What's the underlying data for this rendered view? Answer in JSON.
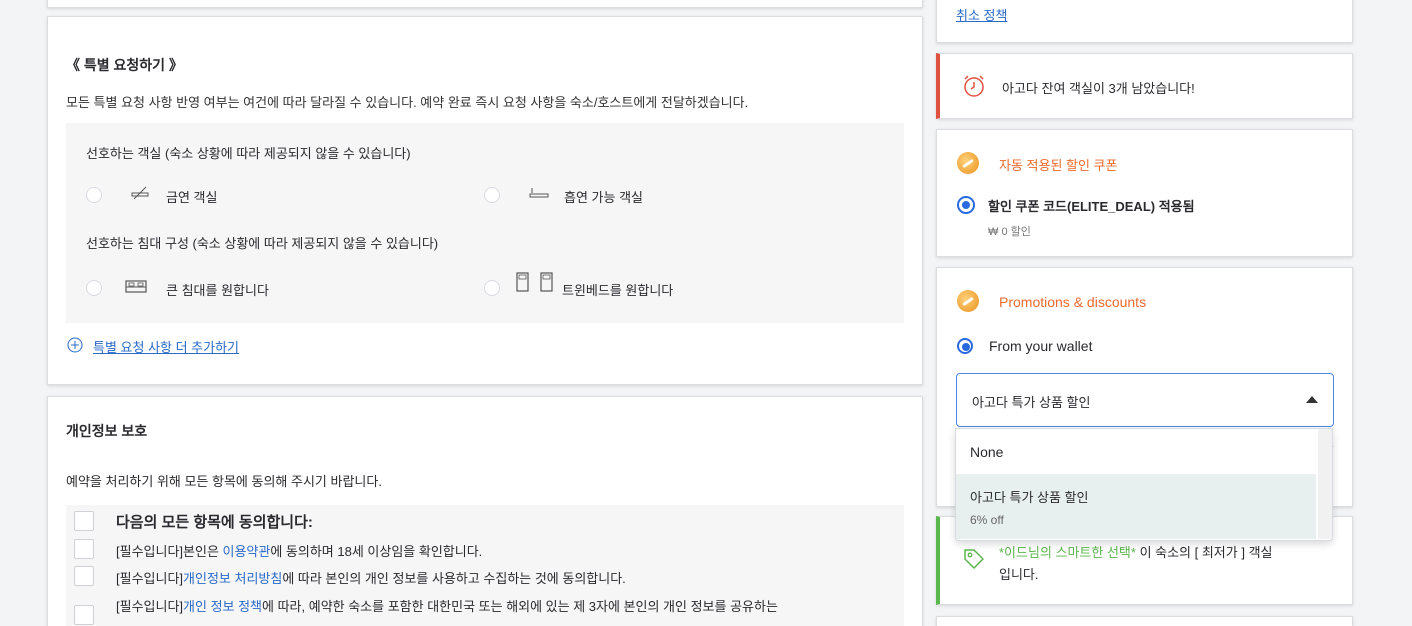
{
  "left": {
    "special": {
      "title": "《 특별 요청하기 》",
      "desc": "모든 특별 요청 사항 반영 여부는 여건에 따라 달라질 수 있습니다. 예약 완료 즉시 요청 사항을 숙소/호스트에게 전달하겠습니다.",
      "room_pref_label": "선호하는 객실 (숙소 상황에 따라 제공되지 않을 수 있습니다)",
      "non_smoking": "금연 객실",
      "smoking": "흡연 가능 객실",
      "bed_pref_label": "선호하는 침대 구성 (숙소 상황에 따라 제공되지 않을 수 있습니다)",
      "large_bed": "큰 침대를 원합니다",
      "twin_bed": "트윈베드를 원합니다",
      "add_more": "특별 요청 사항 더 추가하기"
    },
    "privacy": {
      "title": "개인정보 보호",
      "desc": "예약을 처리하기 위해 모든 항목에 동의해 주시기 바랍니다.",
      "agree_all": "다음의 모든 항목에 동의합니다:",
      "item1_prefix": "[필수입니다]본인은 ",
      "item1_link": "이용약관",
      "item1_suffix": "에 동의하며 18세 이상임을 확인합니다.",
      "item2_prefix": "[필수입니다]",
      "item2_link": "개인정보 처리방침",
      "item2_suffix": "에 따라 본인의 개인 정보를 사용하고 수집하는 것에 동의합니다.",
      "item3_prefix": "[필수입니다]",
      "item3_link": "개인 정보 정책",
      "item3_suffix": "에 따라, 예약한 숙소를 포함한 대한민국 또는 해외에 있는 제 3자에 본인의 개인 정보를 공유하는"
    }
  },
  "right": {
    "cancel_policy": "취소 정책",
    "urgency": "아고다 잔여 객실이 3개 남았습니다!",
    "coupon": {
      "title": "자동 적용된 할인 쿠폰",
      "applied": "할인 쿠폰 코드(ELITE_DEAL) 적용됨",
      "amount": "₩ 0 할인"
    },
    "promotions": {
      "title": "Promotions & discounts",
      "wallet": "From your wallet",
      "selected": "아고다 특가 상품 할인",
      "options": [
        {
          "label": "None",
          "sub": ""
        },
        {
          "label": "아고다 특가 상품 할인",
          "sub": "6% off"
        }
      ]
    },
    "smart_choice": {
      "highlight": "*이드님의 스마트한 선택*",
      "rest": " 이 숙소의 [ 최저가 ] 객실",
      "line2": "입니다."
    }
  },
  "colors": {
    "accent_red": "#e0513f",
    "promo_orange": "#ec6a2d",
    "smart_green": "#5bb64d",
    "link_blue": "#2a6ac8"
  }
}
